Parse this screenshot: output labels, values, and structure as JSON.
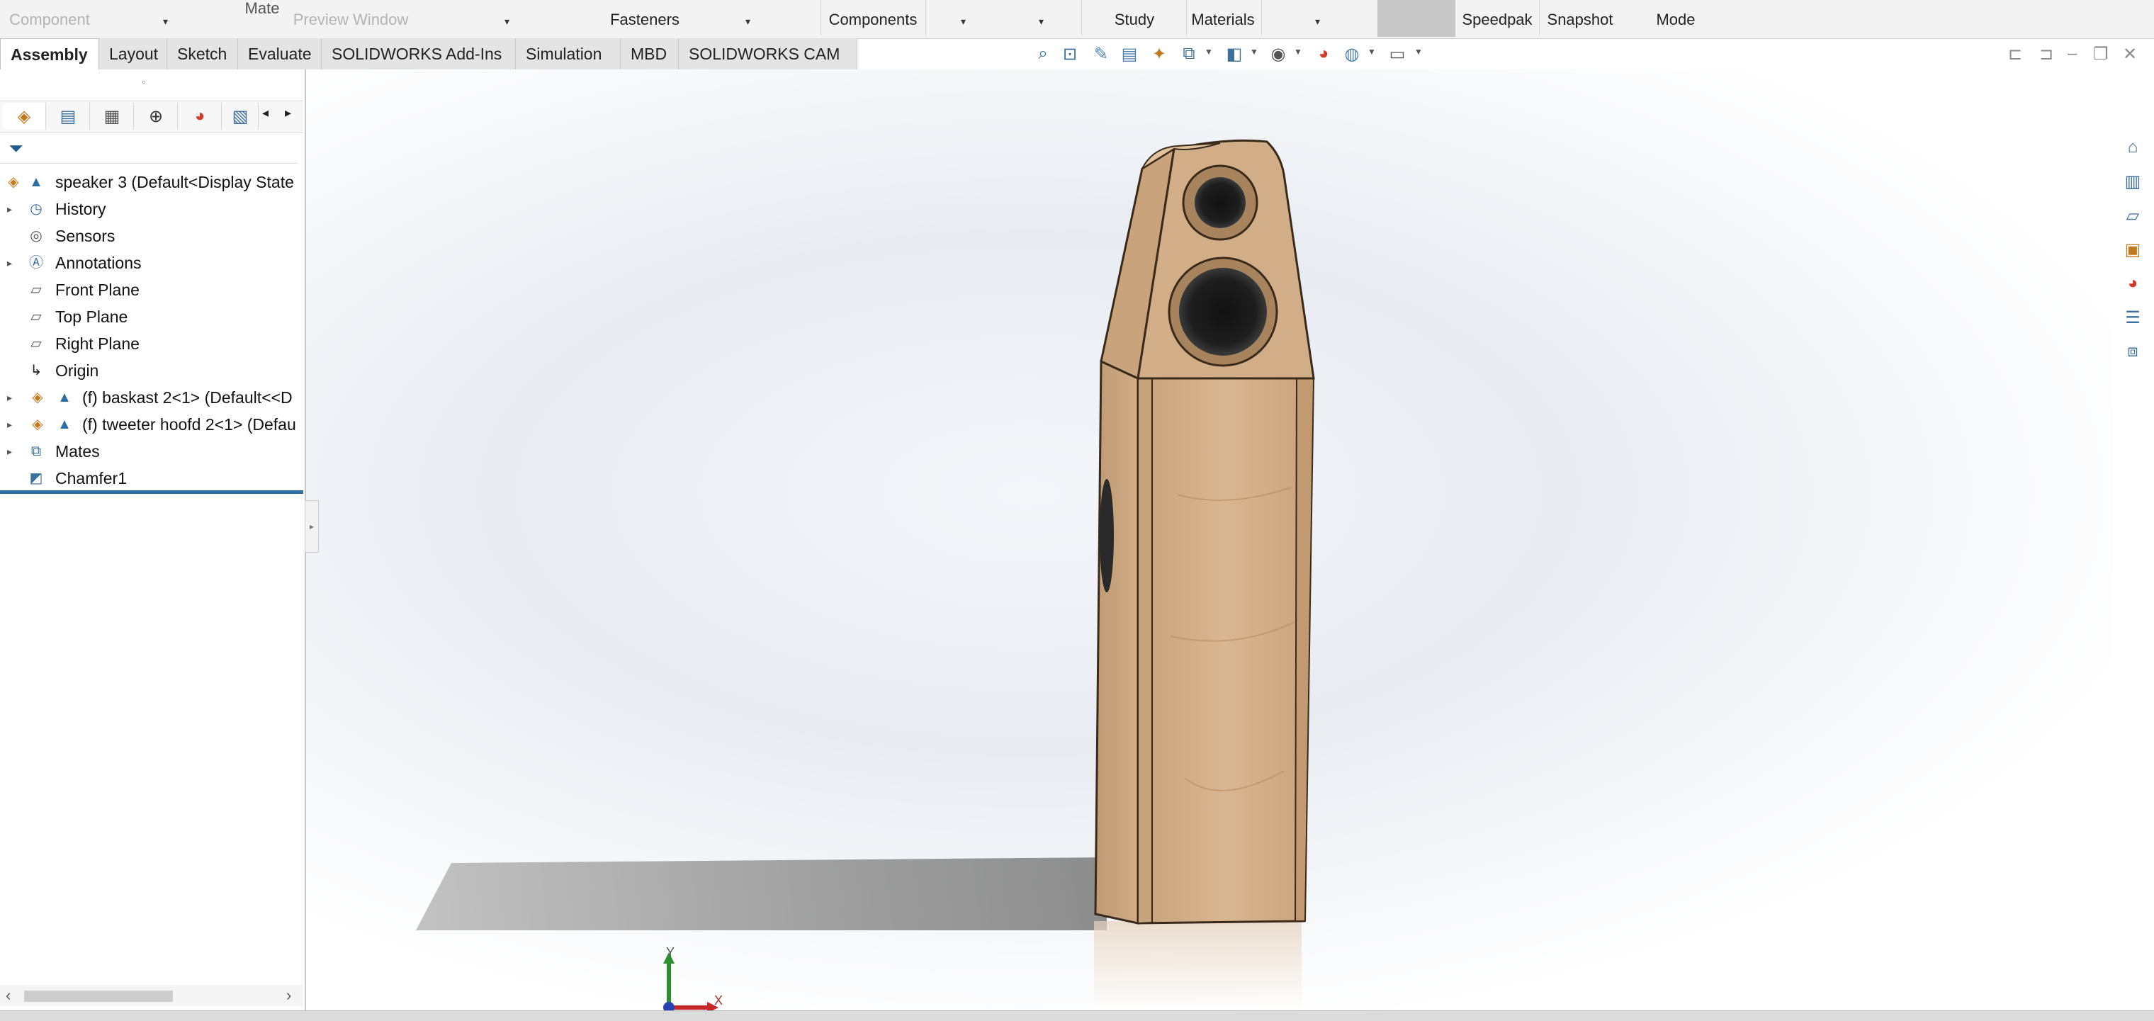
{
  "ribbon": {
    "buttons": [
      {
        "line1": "",
        "line2": "Component",
        "dim": true
      },
      {
        "line1": "Mate",
        "line2": "",
        "dim": false
      },
      {
        "line1": "",
        "line2": "Preview Window",
        "dim": true
      },
      {
        "line1": "",
        "line2": "Fasteners",
        "dim": false
      },
      {
        "line1": "",
        "line2": "Components",
        "dim": false
      },
      {
        "line1": "",
        "line2": "Study",
        "dim": false
      },
      {
        "line1": "",
        "line2": "Materials",
        "dim": false
      },
      {
        "line1": "",
        "line2": "Speedpak",
        "dim": false
      },
      {
        "line1": "",
        "line2": "Snapshot",
        "dim": false
      },
      {
        "line1": "",
        "line2": "Mode",
        "dim": false
      }
    ]
  },
  "tabs": [
    "Assembly",
    "Layout",
    "Sketch",
    "Evaluate",
    "SOLIDWORKS Add-Ins",
    "Simulation",
    "MBD",
    "SOLIDWORKS CAM"
  ],
  "hud_icons": [
    "zoom-to-fit-icon",
    "zoom-to-area-icon",
    "previous-view-icon",
    "section-view-icon",
    "dynamic-annotation-icon",
    "view-orientation-icon",
    "display-style-icon",
    "hide-show-items-icon",
    "edit-appearance-icon",
    "apply-scene-icon",
    "view-settings-icon"
  ],
  "feature_tree": {
    "tabs": [
      "featuremanager-icon",
      "propertymanager-icon",
      "configurationmanager-icon",
      "dimxpertmanager-icon",
      "displaymanager-icon",
      "cam-icon"
    ],
    "items": [
      {
        "label": "speaker 3  (Default<Display State",
        "icon": "assembly-icon",
        "expandable": false,
        "indent": 0
      },
      {
        "label": "History",
        "icon": "history-icon",
        "expandable": true,
        "indent": 1
      },
      {
        "label": "Sensors",
        "icon": "sensors-icon",
        "expandable": false,
        "indent": 1
      },
      {
        "label": "Annotations",
        "icon": "annotations-icon",
        "expandable": true,
        "indent": 1
      },
      {
        "label": "Front Plane",
        "icon": "plane-icon",
        "expandable": false,
        "indent": 1
      },
      {
        "label": "Top Plane",
        "icon": "plane-icon",
        "expandable": false,
        "indent": 1
      },
      {
        "label": "Right Plane",
        "icon": "plane-icon",
        "expandable": false,
        "indent": 1
      },
      {
        "label": "Origin",
        "icon": "origin-icon",
        "expandable": false,
        "indent": 1
      },
      {
        "label": "(f) baskast 2<1> (Default<<D",
        "icon": "part-icon",
        "expandable": true,
        "indent": 1
      },
      {
        "label": "(f) tweeter hoofd 2<1> (Defau",
        "icon": "part-icon",
        "expandable": true,
        "indent": 1
      },
      {
        "label": "Mates",
        "icon": "mates-icon",
        "expandable": true,
        "indent": 1
      },
      {
        "label": "Chamfer1",
        "icon": "chamfer-icon",
        "expandable": false,
        "indent": 1
      }
    ]
  },
  "task_pane": [
    "solidworks-resources-icon",
    "design-library-icon",
    "file-explorer-icon",
    "view-palette-icon",
    "appearances-icon",
    "custom-properties-icon",
    "forum-icon"
  ],
  "triad": {
    "y": "Y",
    "x": "X"
  },
  "colors": {
    "accent": "#2e6ea6",
    "wood": "#d8b48e",
    "background": "#ffffff"
  }
}
